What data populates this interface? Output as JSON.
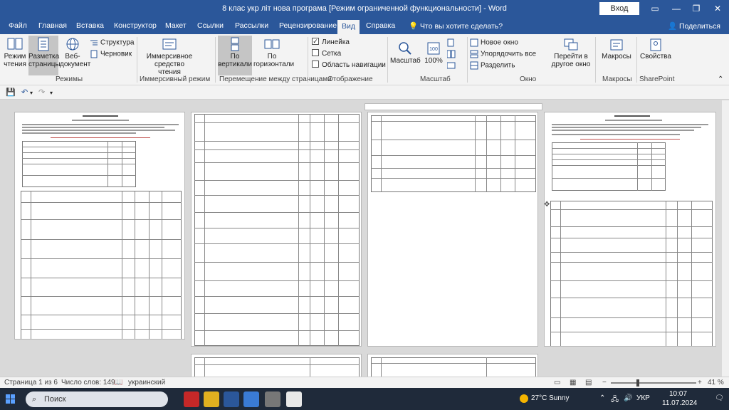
{
  "window": {
    "title": "8 клас укр літ нова програма [Режим ограниченной функциональности] - Word",
    "login_label": "Вход",
    "minimize": "—",
    "maximize": "❐",
    "close": "✕"
  },
  "tabs": [
    "Файл",
    "Главная",
    "Вставка",
    "Конструктор",
    "Макет",
    "Ссылки",
    "Рассылки",
    "Рецензирование",
    "Вид",
    "Справка"
  ],
  "active_tab": "Вид",
  "tell_me": "Что вы хотите сделать?",
  "share_label": "Поделиться",
  "ribbon": {
    "views": {
      "read_mode": "Режим\nчтения",
      "print_layout": "Разметка\nстраницы",
      "web_layout": "Веб-\nдокумент",
      "outline": "Структура",
      "draft": "Черновик",
      "group_label": "Режимы"
    },
    "immersive": {
      "reader": "Иммерсивное\nсредство чтения",
      "group_label": "Иммерсивный режим"
    },
    "page_movement": {
      "vertical": "По\nвертикали",
      "side_to_side": "По\nгоризонтали",
      "group_label": "Перемещение между страницами"
    },
    "show": {
      "ruler": "Линейка",
      "gridlines": "Сетка",
      "nav_pane": "Область навигации",
      "ruler_checked": true,
      "gridlines_checked": false,
      "nav_checked": false,
      "group_label": "Отображение"
    },
    "zoom": {
      "zoom": "Масштаб",
      "hundred": "100%",
      "one_page": "Одна страница",
      "multiple_pages": "Несколько страниц",
      "page_width": "По ширине страницы",
      "group_label": "Масштаб"
    },
    "window": {
      "new_window": "Новое окно",
      "arrange_all": "Упорядочить все",
      "split": "Разделить",
      "switch_windows": "Перейти в\nдругое окно",
      "group_label": "Окно"
    },
    "macros": {
      "macros": "Макросы",
      "group_label": "Макросы"
    },
    "sharepoint": {
      "properties": "Свойства",
      "group_label": "SharePoint"
    }
  },
  "status_bar": {
    "page": "Страница 1 из 6",
    "words": "Число слов: 1490",
    "language": "украинский",
    "zoom_percent": "41 %"
  },
  "taskbar": {
    "search_placeholder": "Поиск",
    "weather": "27°C  Sunny",
    "language": "УКР",
    "time": "10:07",
    "date": "11.07.2024"
  },
  "colors": {
    "accent": "#2b579a",
    "ribbon_bg": "#f3f3f3",
    "taskbar": "#1f2a3a"
  }
}
